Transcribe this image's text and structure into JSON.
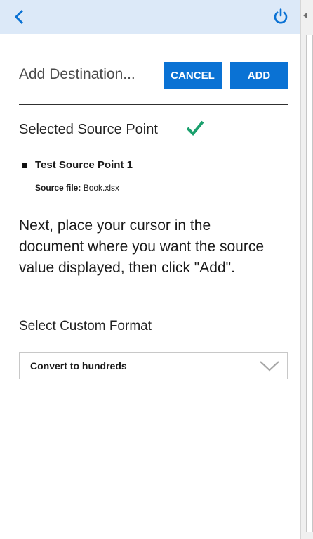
{
  "header": {
    "title": "Add Destination...",
    "cancel_label": "CANCEL",
    "add_label": "ADD"
  },
  "selected": {
    "heading": "Selected Source Point",
    "source_name": "Test Source Point 1",
    "source_file_label": "Source file:",
    "source_file_value": "Book.xlsx"
  },
  "instructions": "Next, place your cursor in the document where you want the source value displayed, then click \"Add\".",
  "format": {
    "label": "Select Custom Format",
    "selected_value": "Convert to hundreds"
  },
  "icons": {
    "back": "chevron-left-icon",
    "power": "power-icon",
    "check": "checkmark-icon",
    "dropdown": "chevron-down-icon"
  },
  "colors": {
    "topbar": "#dce9f8",
    "accent": "#0a72d4",
    "check": "#1aa06d"
  }
}
